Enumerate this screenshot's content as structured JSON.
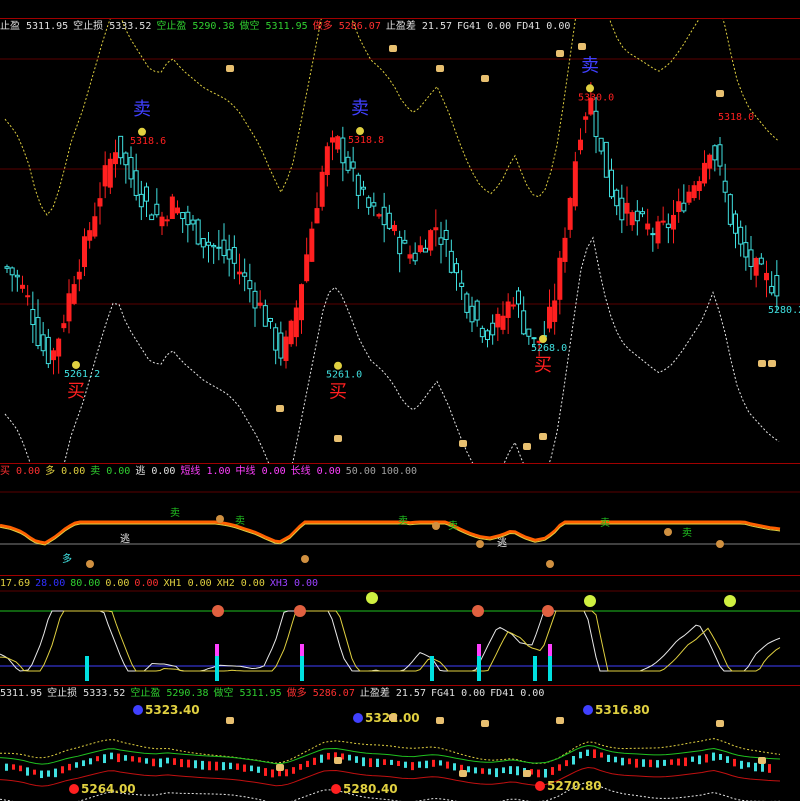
{
  "colors": {
    "up": "#ff2020",
    "down": "#40e0e0",
    "green": "#20c020",
    "dred": "#c01010",
    "yellow": "#e0d040",
    "white": "#e8e8e8",
    "magenta": "#ff40ff",
    "cyan": "#00e0e0",
    "blue": "#4040ff"
  },
  "main": {
    "header": [
      {
        "text": "止盈 5311.95",
        "color": "#e0e0e0"
      },
      {
        "text": "空止损 5333.52",
        "color": "#e0e0e0"
      },
      {
        "text": "空止盈 5290.38",
        "color": "#30d030"
      },
      {
        "text": "做空 5311.95",
        "color": "#30d030"
      },
      {
        "text": "做多 5286.07",
        "color": "#ff3030"
      },
      {
        "text": "止盈差 21.57",
        "color": "#e0e0e0"
      },
      {
        "text": "FG41 0.00",
        "color": "#e0e0e0"
      },
      {
        "text": "FD41 0.00",
        "color": "#e0e0e0"
      }
    ],
    "price_labels": [
      "5318.6",
      "5318.8",
      "5330.0",
      "5318.0",
      "5261.2",
      "5261.0",
      "5268.0",
      "5280.2"
    ],
    "buy_char": "买",
    "sell_char": "卖"
  },
  "sub1": {
    "header": [
      {
        "text": "买 0.00",
        "color": "#ff3030"
      },
      {
        "text": "多 0.00",
        "color": "#e0d040"
      },
      {
        "text": "卖 0.00",
        "color": "#30d030"
      },
      {
        "text": "逃 0.00",
        "color": "#e0e0e0"
      },
      {
        "text": "短线 1.00",
        "color": "#ff40ff"
      },
      {
        "text": "中线 0.00",
        "color": "#ff40ff"
      },
      {
        "text": "长线 0.00",
        "color": "#ff40ff"
      },
      {
        "text": "50.00",
        "color": "#a0a0a0"
      },
      {
        "text": "100.00",
        "color": "#a0a0a0"
      }
    ],
    "mark_chars": [
      "多",
      "卖",
      "逃"
    ]
  },
  "sub2": {
    "header": [
      {
        "text": "17.69",
        "color": "#e0d040"
      },
      {
        "text": "28.00",
        "color": "#3030ff"
      },
      {
        "text": "80.00",
        "color": "#30d030"
      },
      {
        "text": "0.00",
        "color": "#e0d040"
      },
      {
        "text": "0.00",
        "color": "#ff3030"
      },
      {
        "text": "XH1 0.00",
        "color": "#e0d040"
      },
      {
        "text": "XH2 0.00",
        "color": "#e0d040"
      },
      {
        "text": "XH3 0.00",
        "color": "#9a40ff"
      }
    ]
  },
  "mini": {
    "header": [
      {
        "text": "5311.95",
        "color": "#e0e0e0"
      },
      {
        "text": "空止损 5333.52",
        "color": "#e0e0e0"
      },
      {
        "text": "空止盈 5290.38",
        "color": "#30d030"
      },
      {
        "text": "做空 5311.95",
        "color": "#30d030"
      },
      {
        "text": "做多 5286.07",
        "color": "#ff3030"
      },
      {
        "text": "止盈差 21.57",
        "color": "#e0e0e0"
      },
      {
        "text": "FG41 0.00",
        "color": "#e0e0e0"
      },
      {
        "text": "FD41 0.00",
        "color": "#e0e0e0"
      }
    ],
    "price_labels": [
      "5323.40",
      "5322.00",
      "5316.80",
      "5264.00",
      "5280.40",
      "5270.80"
    ]
  },
  "chart_data": {
    "type": "line",
    "series": [
      {
        "values": [
          5285,
          5282,
          5276,
          5265,
          5261,
          5270,
          5282,
          5290,
          5300,
          5310,
          5318,
          5310,
          5305,
          5300,
          5298,
          5302,
          5298,
          5295,
          5292,
          5290,
          5288,
          5285,
          5280,
          5275,
          5268,
          5262,
          5270,
          5285,
          5300,
          5315,
          5318,
          5312,
          5305,
          5300,
          5298,
          5295,
          5290,
          5288,
          5292,
          5296,
          5290,
          5282,
          5275,
          5270,
          5268,
          5272,
          5278,
          5270,
          5265,
          5268,
          5280,
          5300,
          5320,
          5330,
          5315,
          5305,
          5300,
          5298,
          5296,
          5294,
          5296,
          5300,
          5305,
          5310,
          5318,
          5308,
          5295,
          5288,
          5285,
          5282,
          5280
        ]
      }
    ]
  }
}
